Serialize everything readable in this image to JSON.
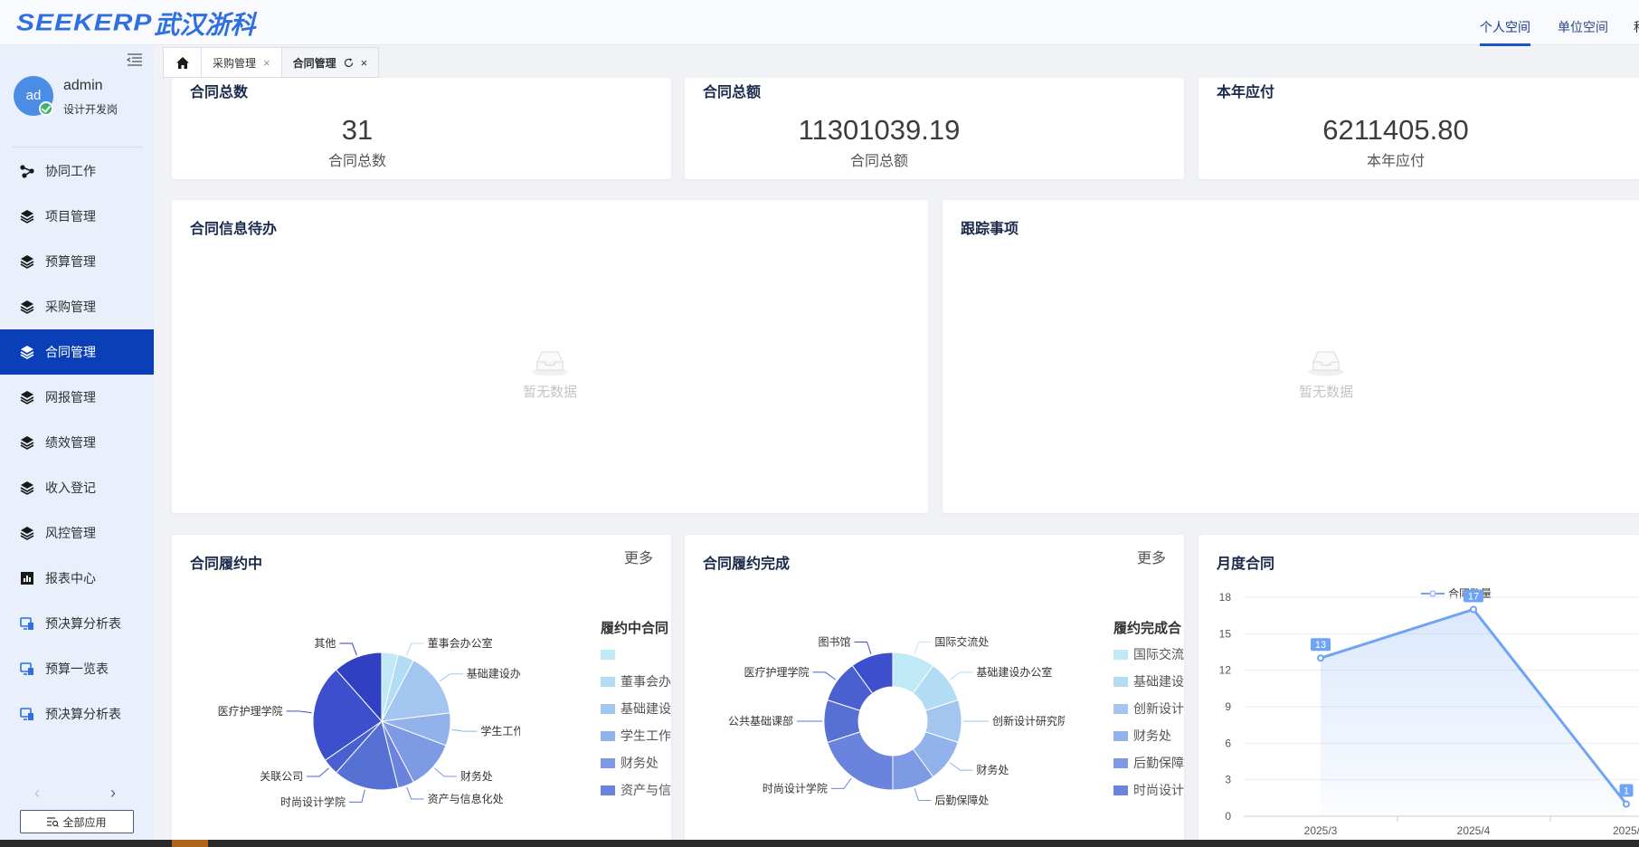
{
  "topbar": {
    "logo_latin": "SEEKERP",
    "logo_cn": "武汉浙科",
    "nav": [
      "个人空间",
      "单位空间",
      "科"
    ]
  },
  "user": {
    "avatar": "ad",
    "name": "admin",
    "role": "设计开发岗"
  },
  "sidebar": {
    "items": [
      {
        "label": "协同工作",
        "icon": "share-icon"
      },
      {
        "label": "项目管理",
        "icon": "layers-icon"
      },
      {
        "label": "预算管理",
        "icon": "layers-icon"
      },
      {
        "label": "采购管理",
        "icon": "layers-icon"
      },
      {
        "label": "合同管理",
        "icon": "layers-icon",
        "active": true
      },
      {
        "label": "网报管理",
        "icon": "layers-icon"
      },
      {
        "label": "绩效管理",
        "icon": "layers-icon"
      },
      {
        "label": "收入登记",
        "icon": "layers-icon"
      },
      {
        "label": "风控管理",
        "icon": "layers-icon"
      },
      {
        "label": "报表中心",
        "icon": "report-icon"
      },
      {
        "label": "预决算分析表",
        "icon": "monitor-icon"
      },
      {
        "label": "预算一览表",
        "icon": "monitor-icon"
      },
      {
        "label": "预决算分析表",
        "icon": "monitor-icon"
      }
    ],
    "all_apps": "全部应用",
    "accent": "#0b3fb8"
  },
  "tabs": [
    {
      "label": "采购管理"
    },
    {
      "label": "合同管理",
      "active": true
    }
  ],
  "stats": [
    {
      "title": "合同总数",
      "value": "31",
      "label": "合同总数"
    },
    {
      "title": "合同总额",
      "value": "11301039.19",
      "label": "合同总额"
    },
    {
      "title": "本年应付",
      "value": "6211405.80",
      "label": "本年应付"
    }
  ],
  "panels": {
    "todo": {
      "title": "合同信息待办",
      "empty": "暂无数据"
    },
    "tracking": {
      "title": "跟踪事项",
      "empty": "暂无数据"
    }
  },
  "more_label": "更多",
  "charts": {
    "in_progress": {
      "title": "合同履约中",
      "legend_title": "履约中合同"
    },
    "completed": {
      "title": "合同履约完成",
      "legend_title": "履约完成合"
    },
    "monthly": {
      "title": "月度合同"
    }
  },
  "chart_data": [
    {
      "type": "pie",
      "title": "合同履约中",
      "legend_title": "履约中合同",
      "labels": [
        "",
        "董事会办公室",
        "基础建设办公室",
        "学生工作部（红安）",
        "财务处",
        "资产与信息化处",
        "时尚设计学院",
        "关联公司",
        "医疗护理学院",
        "其他"
      ],
      "legend_entries": [
        "",
        "董事会办",
        "基础建设",
        "学生工作",
        "财务处",
        "资产与信"
      ],
      "values": [
        1,
        1,
        4,
        2,
        3,
        1,
        4,
        1,
        6,
        3
      ],
      "colors": [
        "#bfeaf5",
        "#b1dcf3",
        "#a3c6f0",
        "#92b2ec",
        "#7f9ae4",
        "#6a83dc",
        "#5670d4",
        "#4a5fd0",
        "#3d4fcc",
        "#3040c2"
      ]
    },
    {
      "type": "pie",
      "title": "合同履约完成",
      "legend_title": "履约完成合",
      "labels": [
        "国际交流处",
        "基础建设办公室",
        "创新设计研究院",
        "财务处",
        "后勤保障处",
        "时尚设计学院",
        "公共基础课部",
        "医疗护理学院",
        "图书馆"
      ],
      "legend_entries": [
        "国际交流",
        "基础建设",
        "创新设计",
        "财务处",
        "后勤保障",
        "时尚设计"
      ],
      "values": [
        2,
        2,
        2,
        2,
        2,
        4,
        2,
        2,
        2
      ],
      "colors": [
        "#bfeaf5",
        "#b1dcf3",
        "#a3c6f0",
        "#92b2ec",
        "#7f9ae4",
        "#6a83dc",
        "#5670d4",
        "#4a5fd0",
        "#3d4fcc"
      ]
    },
    {
      "type": "line",
      "title": "月度合同",
      "series": [
        {
          "name": "合同数量",
          "values": [
            13,
            17,
            1
          ]
        }
      ],
      "x": [
        "2025/3",
        "2025/4",
        "2025/"
      ],
      "ylim": [
        0,
        18
      ],
      "yticks": [
        0,
        3,
        6,
        9,
        12,
        15,
        18
      ],
      "color": "#6fa3f5"
    }
  ]
}
